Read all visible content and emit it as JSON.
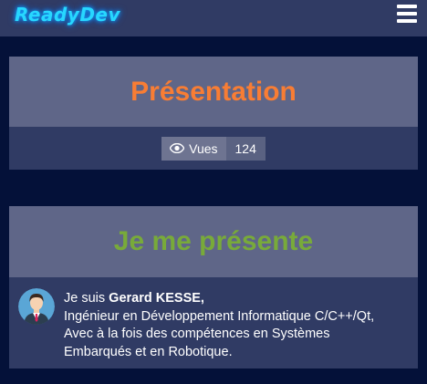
{
  "navbar": {
    "logo": "ReadyDev",
    "menu_icon": "hamburger-menu-icon"
  },
  "presentation": {
    "title": "Présentation",
    "views_icon": "eye-icon",
    "views_label": "Vues",
    "views_count": "124"
  },
  "intro": {
    "title": "Je me présente",
    "avatar_icon": "avatar-man-icon",
    "line1_prefix": "Je suis ",
    "line1_name": "Gerard KESSE,",
    "line2": "Ingénieur en Développement Informatique C/C++/Qt,",
    "line3": "Avec à la fois des compétences en Systèmes",
    "line4": "Embarqués et en Robotique."
  },
  "colors": {
    "page_background": "#041139",
    "navbar": "#303b64",
    "card_header": "#5f6688",
    "card_body": "#303b64",
    "logo": "#27d7ff",
    "presentation_title": "#f87d34",
    "intro_title": "#78aa3a"
  }
}
